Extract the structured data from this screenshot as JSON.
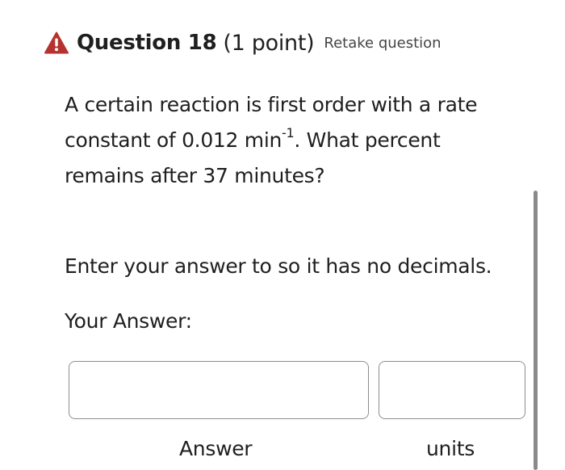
{
  "header": {
    "icon": "warning-icon",
    "icon_color": "#b5322e",
    "title": "Question 18",
    "points": "(1 point)",
    "retake_label": "Retake question"
  },
  "question": {
    "text_before_sup": "A certain reaction is first order with a rate constant of 0.012 min",
    "superscript": "-1",
    "text_after_sup": ". What percent remains after 37 minutes?"
  },
  "instruction": "Enter your answer to so it has no decimals.",
  "your_answer_label": "Your Answer:",
  "fields": {
    "answer": {
      "value": "",
      "label": "Answer"
    },
    "units": {
      "value": "",
      "label": "units"
    }
  }
}
